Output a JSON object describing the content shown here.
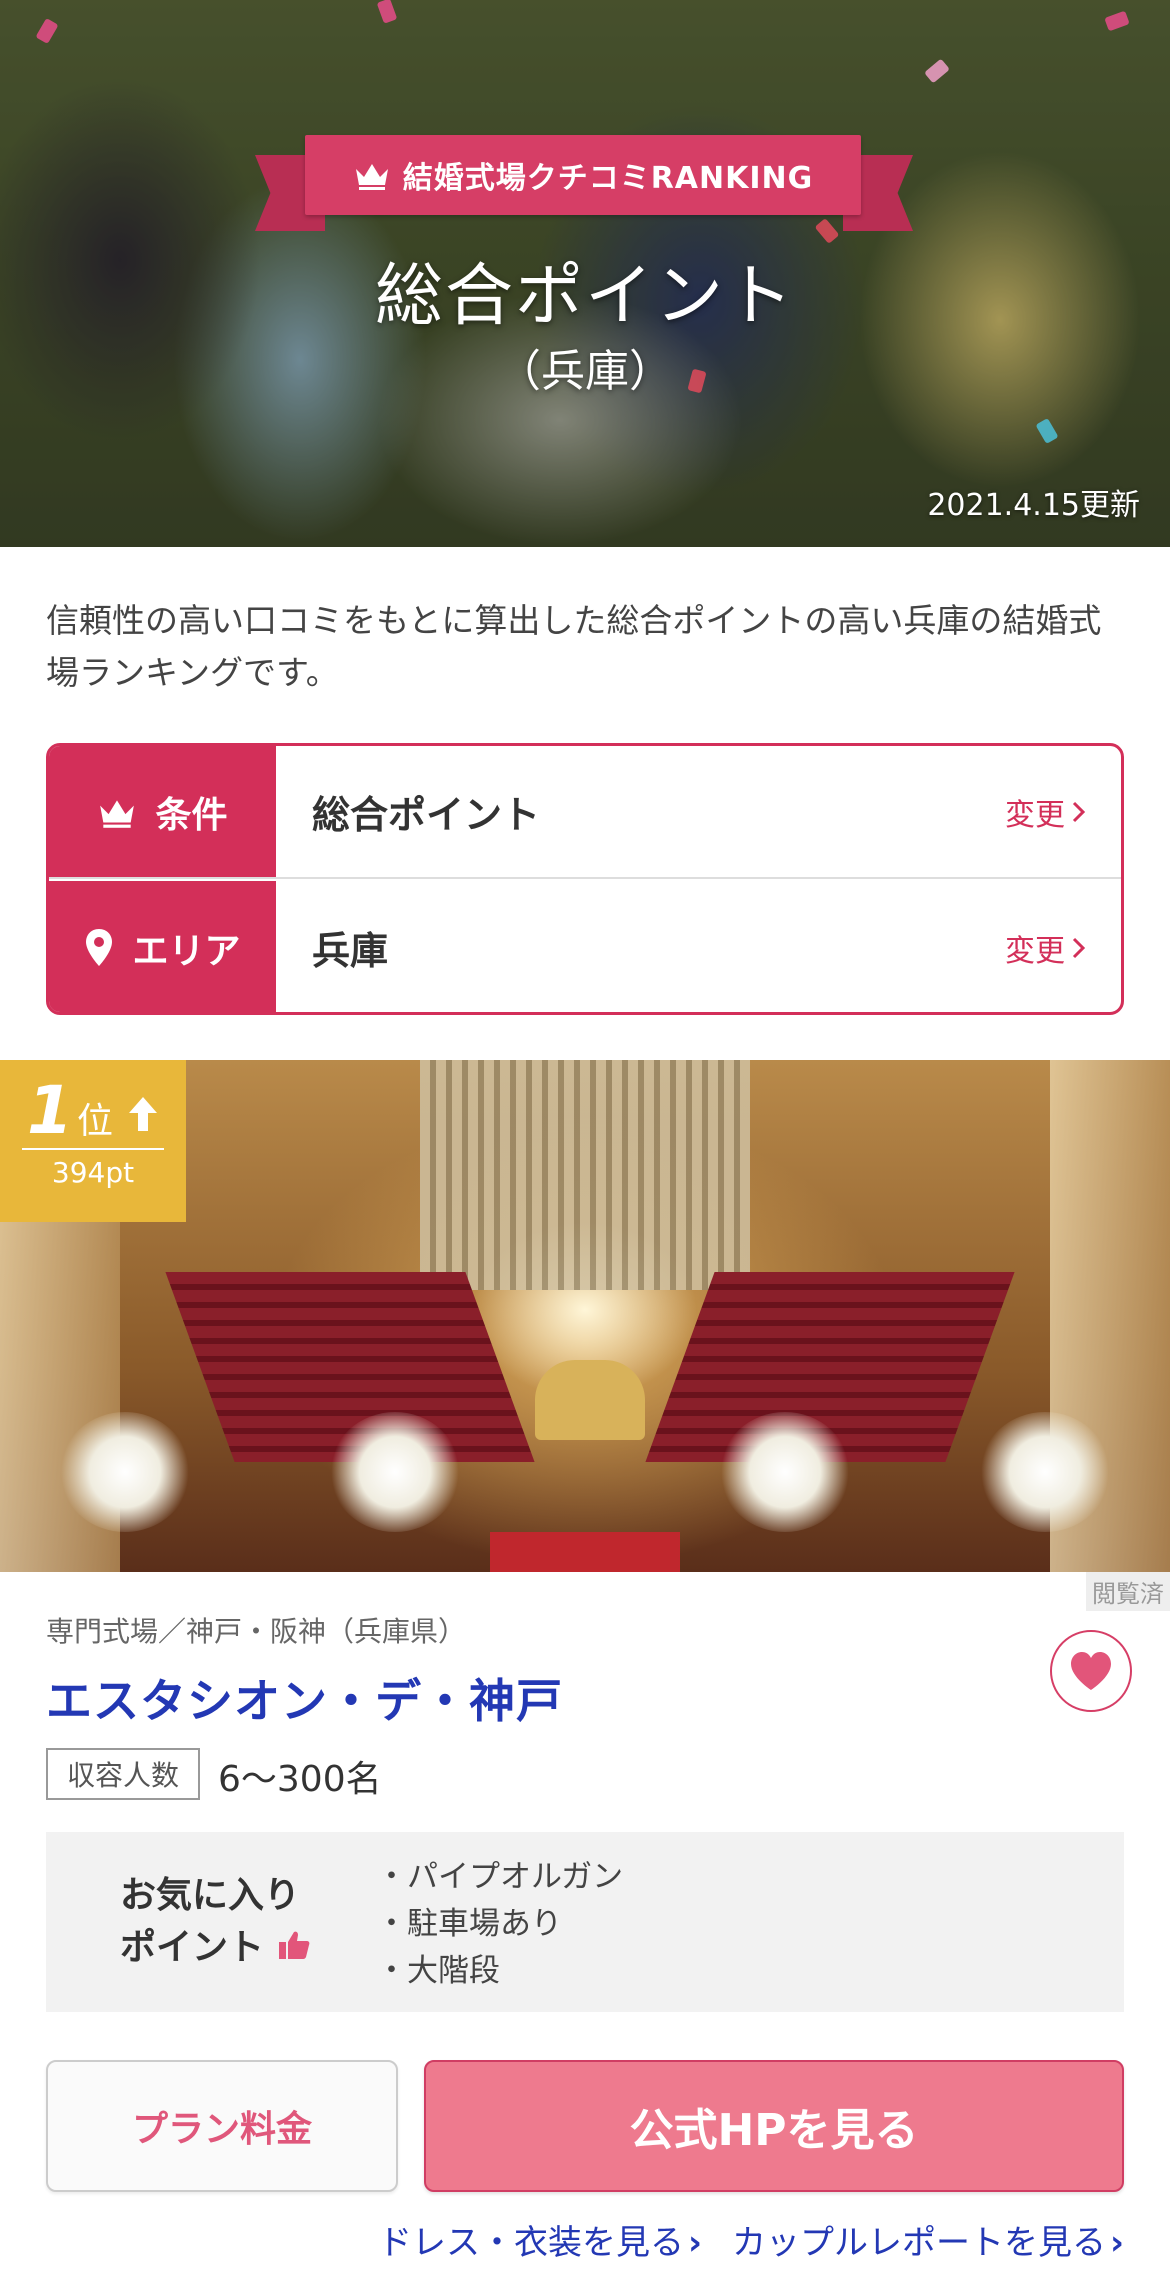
{
  "hero": {
    "banner": "結婚式場クチコミRANKING",
    "title": "総合ポイント",
    "subtitle": "（兵庫）",
    "updated": "2021.4.15更新"
  },
  "description": "信頼性の高い口コミをもとに算出した総合ポイントの高い兵庫の結婚式場ランキングです。",
  "conditions": [
    {
      "label": "条件",
      "value": "総合ポイント",
      "change": "変更",
      "icon": "crown-icon"
    },
    {
      "label": "エリア",
      "value": "兵庫",
      "change": "変更",
      "icon": "map-pin-icon"
    }
  ],
  "venue": {
    "rank": "1",
    "rank_suffix": "位",
    "rank_trend": "up",
    "points": "394pt",
    "viewed": "閲覧済",
    "category": "専門式場／神戸・阪神（兵庫県）",
    "name": "エスタシオン・デ・神戸",
    "capacity_label": "収容人数",
    "capacity_value": "6〜300名",
    "favorite_title_line1": "お気に入り",
    "favorite_title_line2": "ポイント",
    "favorite_points": [
      "・パイプオルガン",
      "・駐車場あり",
      "・大階段"
    ]
  },
  "buttons": {
    "plan": "プラン料金",
    "official": "公式HPを見る"
  },
  "links": {
    "dress": "ドレス・衣装を見る",
    "report": "カップルレポートを見る"
  },
  "colors": {
    "accent": "#d32f59",
    "link": "#2338b4",
    "badge": "#e8b73a",
    "cta": "#ee7a8e"
  }
}
